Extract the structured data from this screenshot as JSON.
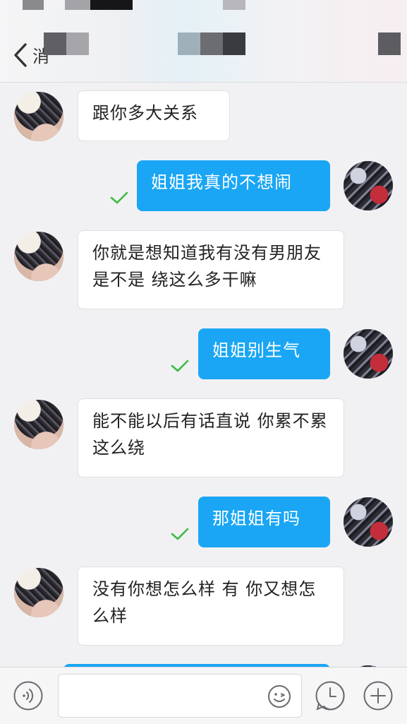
{
  "header": {
    "back_label": "消"
  },
  "messages": [
    {
      "side": "left",
      "text": "跟你多大关系"
    },
    {
      "side": "right",
      "text": "姐姐我真的不想闹",
      "read": true
    },
    {
      "side": "left",
      "text": "你就是想知道我有没有男朋友是不是 绕这么多干嘛"
    },
    {
      "side": "right",
      "text": "姐姐别生气",
      "read": true
    },
    {
      "side": "left",
      "text": "能不能以后有话直说 你累不累这么绕"
    },
    {
      "side": "right",
      "text": "那姐姐有吗",
      "read": true
    },
    {
      "side": "left",
      "text": "没有你想怎么样 有 你又想怎么样"
    }
  ],
  "input": {
    "value": "",
    "placeholder": ""
  },
  "colors": {
    "sent_bubble": "#1aa6f4",
    "received_bubble": "#ffffff",
    "read_check": "#3dbb45"
  }
}
